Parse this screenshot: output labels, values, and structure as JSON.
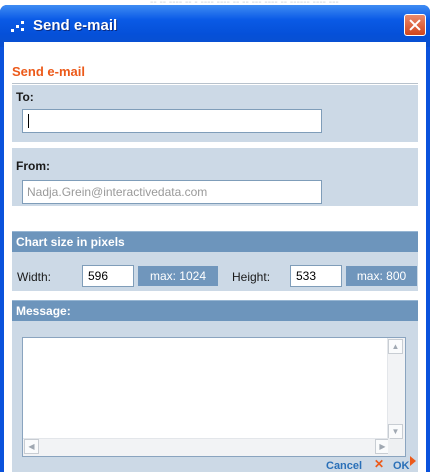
{
  "window": {
    "title": "Send e-mail"
  },
  "header": {
    "title": "Send e-mail"
  },
  "to": {
    "label": "To:",
    "value": ""
  },
  "from": {
    "label": "From:",
    "value": "Nadja.Grein@interactivedata.com"
  },
  "chart_size": {
    "section_label": "Chart size in pixels",
    "width_label": "Width:",
    "width_value": "596",
    "width_max": "max: 1024",
    "height_label": "Height:",
    "height_value": "533",
    "height_max": "max: 800"
  },
  "message": {
    "label": "Message:",
    "value": ""
  },
  "footer": {
    "cancel_label": "Cancel",
    "ok_label": "OK"
  },
  "colors": {
    "accent": "#ec5a1a",
    "titlebar": "#0a52dc",
    "section_bar": "#6d95bc",
    "panel": "#ccd9e6"
  }
}
